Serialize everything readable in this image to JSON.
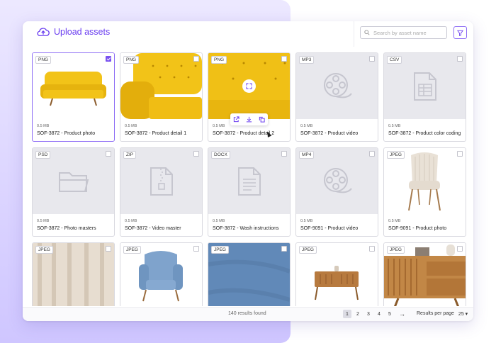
{
  "header": {
    "upload_label": "Upload assets",
    "search_placeholder": "Search by asset name"
  },
  "assets": [
    {
      "type": "PNG",
      "size": "0.5 MB",
      "name": "SOF-3872 - Product photo",
      "selected": true
    },
    {
      "type": "PNG",
      "size": "0.5 MB",
      "name": "SOF-3872 - Product detail 1",
      "selected": false
    },
    {
      "type": "PNG",
      "size": "0.5 MB",
      "name": "SOF-3872 - Product detail 2",
      "selected": false
    },
    {
      "type": "MP3",
      "size": "0.5 MB",
      "name": "SOF-3872 - Product video",
      "selected": false
    },
    {
      "type": "CSV",
      "size": "0.5 MB",
      "name": "SOF-3872 - Product color coding",
      "selected": false
    },
    {
      "type": "PSD",
      "size": "0.5 MB",
      "name": "SOF-3872 - Photo masters",
      "selected": false
    },
    {
      "type": "ZIP",
      "size": "0.5 MB",
      "name": "SOF-3872 - Video master",
      "selected": false
    },
    {
      "type": "DOCX",
      "size": "0.5 MB",
      "name": "SOF-3872 - Wash instructions",
      "selected": false
    },
    {
      "type": "MP4",
      "size": "0.5 MB",
      "name": "SOF-9091 - Product video",
      "selected": false
    },
    {
      "type": "JPEG",
      "size": "0.5 MB",
      "name": "SOF-9091 - Product photo",
      "selected": false
    },
    {
      "type": "JPEG"
    },
    {
      "type": "JPEG"
    },
    {
      "type": "JPEG"
    },
    {
      "type": "JPEG"
    },
    {
      "type": "JPEG"
    }
  ],
  "footer": {
    "results": "140 results found",
    "pages": [
      "1",
      "2",
      "3",
      "4",
      "5"
    ],
    "current_page": "1",
    "next": "→",
    "rpp_label": "Results per page",
    "rpp_value": "25"
  },
  "colors": {
    "accent": "#6a3df0",
    "sofa_yellow": "#f2c318"
  }
}
